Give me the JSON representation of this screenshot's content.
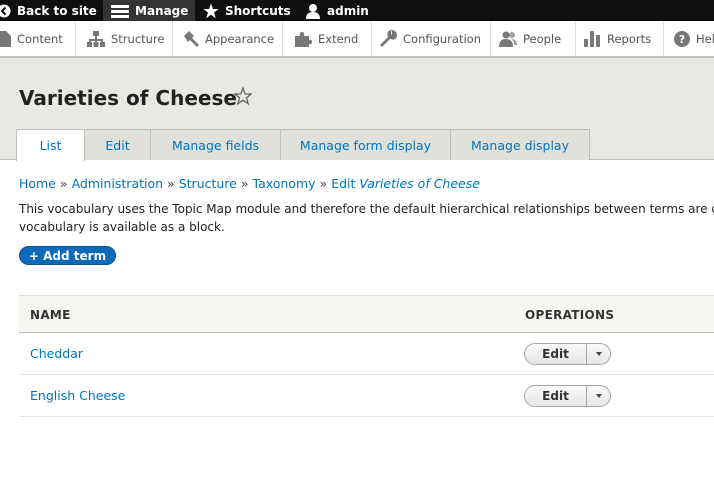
{
  "toolbar": {
    "back_label": "Back to site",
    "manage_label": "Manage",
    "shortcuts_label": "Shortcuts",
    "user_label": "admin"
  },
  "tray": {
    "items": [
      {
        "label": "Content",
        "icon": "content-icon"
      },
      {
        "label": "Structure",
        "icon": "structure-icon"
      },
      {
        "label": "Appearance",
        "icon": "appearance-icon"
      },
      {
        "label": "Extend",
        "icon": "extend-icon"
      },
      {
        "label": "Configuration",
        "icon": "configuration-icon"
      },
      {
        "label": "People",
        "icon": "people-icon"
      },
      {
        "label": "Reports",
        "icon": "reports-icon"
      },
      {
        "label": "Help",
        "icon": "help-icon"
      }
    ]
  },
  "page": {
    "title": "Varieties of Cheese"
  },
  "tabs": [
    {
      "label": "List",
      "active": true
    },
    {
      "label": "Edit"
    },
    {
      "label": "Manage fields"
    },
    {
      "label": "Manage form display"
    },
    {
      "label": "Manage display"
    }
  ],
  "breadcrumb": {
    "items": [
      "Home",
      "Administration",
      "Structure",
      "Taxonomy"
    ],
    "last_prefix": "Edit",
    "last_emphasis": "Varieties of Cheese",
    "separator": "»"
  },
  "description": {
    "line1": "This vocabulary uses the Topic Map module and therefore the default hierarchical relationships between terms are disabled. A topic map of this",
    "line2": "vocabulary is available as a block."
  },
  "actions": {
    "add_term_label": "+ Add term"
  },
  "table": {
    "headers": {
      "name": "NAME",
      "operations": "OPERATIONS"
    },
    "rows": [
      {
        "name": "Cheddar",
        "operation": "Edit"
      },
      {
        "name": "English Cheese",
        "operation": "Edit"
      }
    ]
  },
  "colors": {
    "link": "#0074bd",
    "toolbar": "#0f0f0f",
    "header_bg": "#e9e9e4",
    "primary_button": "#0d6ab8"
  }
}
